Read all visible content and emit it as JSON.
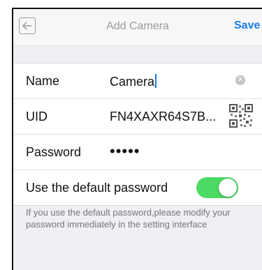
{
  "nav": {
    "title": "Add Camera",
    "save_label": "Save",
    "back_icon": "back-arrow-icon"
  },
  "fields": {
    "name": {
      "label": "Name",
      "value": "Camera",
      "clear_icon": "clear-icon"
    },
    "uid": {
      "label": "UID",
      "value": "FN4XAXR64S7B...",
      "qr_icon": "qr-code-icon"
    },
    "password": {
      "label": "Password",
      "value": "•••••"
    },
    "default_password": {
      "label": "Use the default password",
      "on": true
    }
  },
  "footnote": "If you use the default password,please modify your password immediately in the setting interface",
  "colors": {
    "accent": "#1a7ce8",
    "toggle_on": "#4cd964",
    "background": "#efeff4"
  }
}
